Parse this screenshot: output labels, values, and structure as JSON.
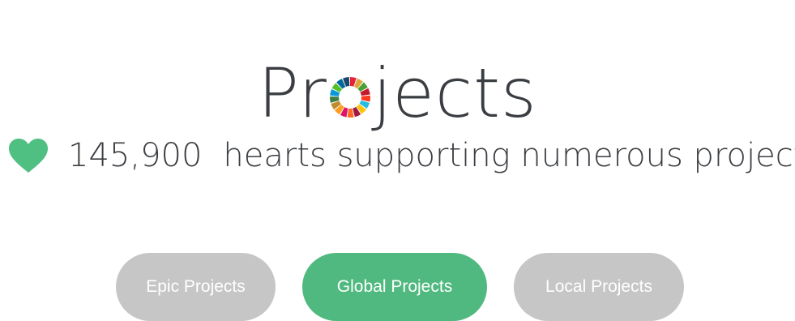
{
  "header": {
    "title_before_logo": "Pr",
    "title_after_logo": "jects",
    "logo_name": "sdg-color-wheel-icon",
    "sdg_colors": [
      "#e5243b",
      "#dda63a",
      "#4c9f38",
      "#c5192d",
      "#ff3a21",
      "#26bde2",
      "#fcc30b",
      "#a21942",
      "#fd6925",
      "#dd1367",
      "#fd9d24",
      "#bf8b2e",
      "#3f7e44",
      "#0a97d9",
      "#56c02b",
      "#00689d",
      "#19486a"
    ]
  },
  "stats": {
    "icon": "heart-icon",
    "count": "145,900",
    "label": "hearts supporting numerous projects",
    "heart_color": "#4fbf82"
  },
  "tabs": [
    {
      "label": "Epic Projects",
      "active": false,
      "color": "#c6c6c6"
    },
    {
      "label": "Global Projects",
      "active": true,
      "color": "#4fb97f"
    },
    {
      "label": "Local Projects",
      "active": false,
      "color": "#c6c6c6"
    }
  ]
}
